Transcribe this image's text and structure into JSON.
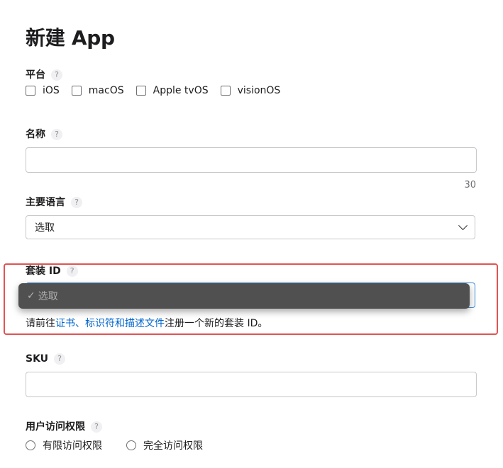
{
  "page": {
    "title": "新建 App"
  },
  "platform": {
    "label": "平台",
    "help": "?",
    "options": [
      "iOS",
      "macOS",
      "Apple tvOS",
      "visionOS"
    ]
  },
  "name_field": {
    "label": "名称",
    "help": "?",
    "value": "",
    "counter": "30"
  },
  "primary_language": {
    "label": "主要语言",
    "help": "?",
    "selected": "选取"
  },
  "bundle_id": {
    "label": "套装 ID",
    "help": "?",
    "popup_option": "选取",
    "popup_check": "✓",
    "hint_prefix": "请前往",
    "hint_link": "证书、标识符和描述文件",
    "hint_suffix": "注册一个新的套装 ID。"
  },
  "sku": {
    "label": "SKU",
    "help": "?",
    "value": ""
  },
  "user_access": {
    "label": "用户访问权限",
    "help": "?",
    "options": [
      "有限访问权限",
      "完全访问权限"
    ]
  },
  "colors": {
    "link": "#0066cc",
    "highlight_border": "#e05353",
    "focus_border": "#3a8bd8",
    "popup_bg": "#505050"
  }
}
